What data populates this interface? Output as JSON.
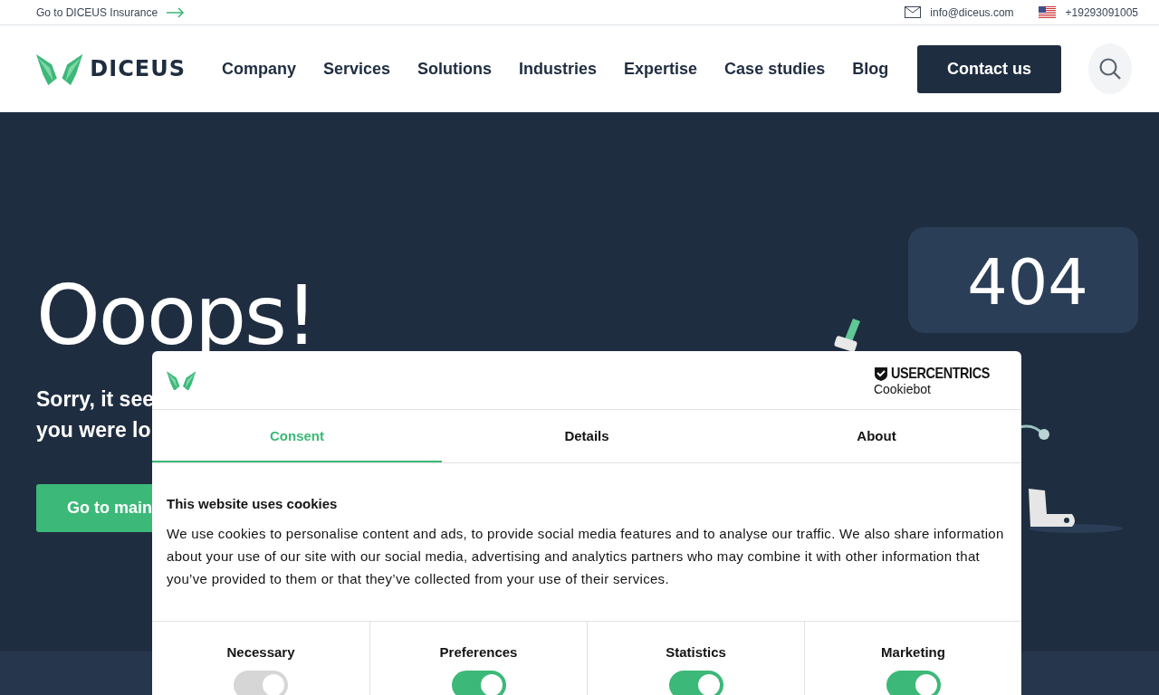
{
  "top_bar": {
    "insurance_link": "Go to DICEUS Insurance",
    "email": "info@diceus.com",
    "phone": "+19293091005"
  },
  "header": {
    "logo": "DICEUS",
    "nav": [
      "Company",
      "Services",
      "Solutions",
      "Industries",
      "Expertise",
      "Case studies",
      "Blog"
    ],
    "contact_button": "Contact us"
  },
  "hero": {
    "title": "Ooops!",
    "subtitle_lines": [
      "Sorry, it see",
      "you were lo"
    ],
    "button": "Go to main",
    "bubble": "404"
  },
  "cookie_dialog": {
    "brand": "USERCENTRICS",
    "brand_sub": "Cookiebot",
    "tabs": [
      {
        "label": "Consent",
        "selected": true
      },
      {
        "label": "Details",
        "selected": false
      },
      {
        "label": "About",
        "selected": false
      }
    ],
    "heading": "This website uses cookies",
    "body": "We use cookies to personalise content and ads, to provide social media features and to analyse our traffic. We also share information about your use of our site with our social media, advertising and analytics partners who may combine it with other information that you’ve provided to them or that they’ve collected from your use of their services.",
    "categories": [
      {
        "label": "Necessary",
        "on": true,
        "disabled": true
      },
      {
        "label": "Preferences",
        "on": true,
        "disabled": false
      },
      {
        "label": "Statistics",
        "on": true,
        "disabled": false
      },
      {
        "label": "Marketing",
        "on": true,
        "disabled": false
      }
    ]
  }
}
